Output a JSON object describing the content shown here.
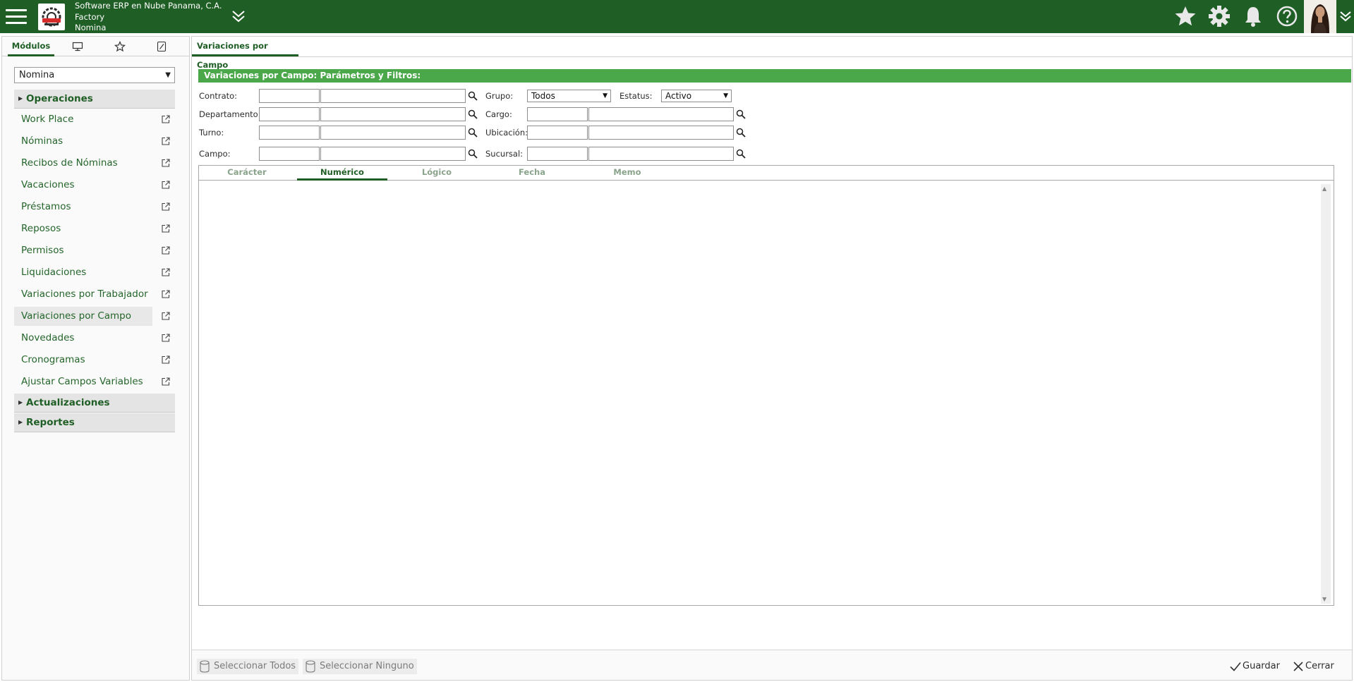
{
  "header": {
    "company_name": "Software ERP en Nube Panama, C.A.",
    "division": "Factory",
    "module": "Nomina",
    "bg_color": "#1f5e25",
    "icons": [
      "menu-icon",
      "double-chevron-down-icon",
      "star-icon",
      "gear-icon",
      "bell-icon",
      "help-icon",
      "chevron-down-icon"
    ]
  },
  "sidebar": {
    "tabs": [
      {
        "label": "Módulos",
        "icon": ""
      },
      {
        "label": "",
        "icon": "monitor-icon"
      },
      {
        "label": "",
        "icon": "star-icon"
      },
      {
        "label": "",
        "icon": "pencil-icon"
      }
    ],
    "module_select": "Nomina",
    "sections": {
      "operaciones": "Operaciones",
      "actualizaciones": "Actualizaciones",
      "reportes": "Reportes"
    },
    "items": [
      {
        "label": "Work Place"
      },
      {
        "label": "Nóminas"
      },
      {
        "label": "Recibos de Nóminas"
      },
      {
        "label": "Vacaciones"
      },
      {
        "label": "Préstamos"
      },
      {
        "label": "Reposos"
      },
      {
        "label": "Permisos"
      },
      {
        "label": "Liquidaciones"
      },
      {
        "label": "Variaciones por Trabajador"
      },
      {
        "label": "Variaciones por Campo"
      },
      {
        "label": "Novedades"
      },
      {
        "label": "Cronogramas"
      },
      {
        "label": "Ajustar Campos Variables"
      }
    ],
    "selected_item": "Variaciones por Campo"
  },
  "main": {
    "tab_title": "Variaciones por Campo",
    "filter_title": "Variaciones por Campo: Parámetros y Filtros:",
    "filter_color": "#4aa74a",
    "labels": {
      "contrato": "Contrato:",
      "departamento": "Departamento:",
      "turno": "Turno:",
      "campo": "Campo:",
      "grupo": "Grupo:",
      "estatus": "Estatus:",
      "cargo": "Cargo:",
      "ubicacion": "Ubicación:",
      "sucursal": "Sucursal:"
    },
    "values": {
      "grupo": "Todos",
      "estatus": "Activo"
    },
    "grid_tabs": [
      "Carácter",
      "Numérico",
      "Lógico",
      "Fecha",
      "Memo"
    ],
    "active_grid_tab": "Numérico"
  },
  "footer": {
    "select_all": "Seleccionar Todos",
    "select_none": "Seleccionar Ninguno",
    "save": "Guardar",
    "close": "Cerrar"
  }
}
